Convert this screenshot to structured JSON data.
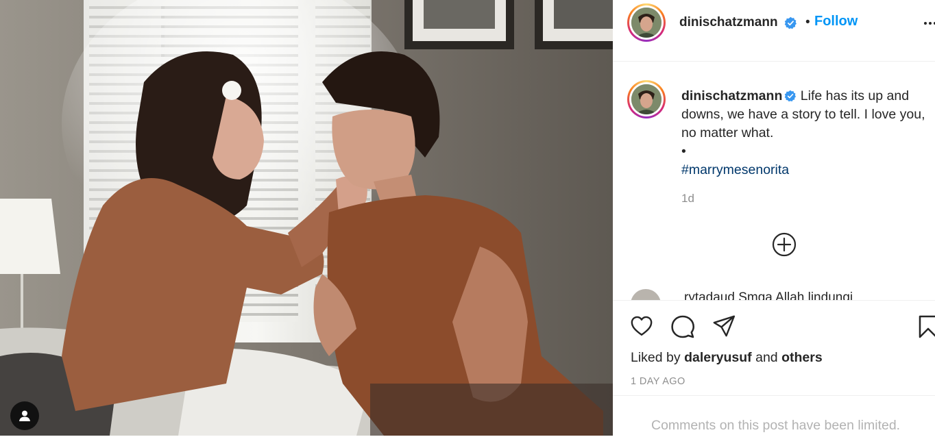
{
  "post": {
    "image_alt": "Couple sitting on a bed by a window",
    "tag_icon": "person-icon"
  },
  "header": {
    "username": "dinischatzmann",
    "separator": "•",
    "follow_label": "Follow",
    "verified_icon": "verified-badge-icon",
    "more_icon": "more-options-icon"
  },
  "caption": {
    "username": "dinischatzmann",
    "text": "Life has its up and downs, we have a story to tell. I love you, no matter what.",
    "bullet": "•",
    "hashtag": "#marrymesenorita",
    "time": "1d"
  },
  "load_more_icon": "plus-circle-icon",
  "next_comment": {
    "text": "rytadaud Smga Allah lindungi"
  },
  "actions": {
    "like_icon": "heart-icon",
    "comment_icon": "comment-icon",
    "share_icon": "share-icon",
    "save_icon": "bookmark-icon",
    "liked_by_prefix": "Liked by",
    "liked_by_user": "daleryusuf",
    "liked_by_and": "and",
    "liked_by_others": "others",
    "date": "1 DAY AGO",
    "comments_limited": "Comments on this post have been limited."
  },
  "colors": {
    "accent": "#0095f6",
    "hashtag": "#00376b",
    "muted": "#8e8e8e",
    "text": "#262626"
  }
}
